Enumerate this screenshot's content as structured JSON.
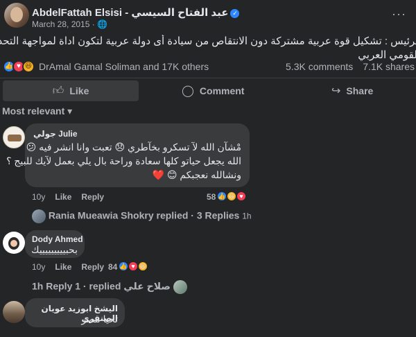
{
  "post": {
    "page_name": "AbdelFattah Elsisi - عبد الفتاح السيسي",
    "date": "March 28, 2015 · ",
    "text_line1": "الرئيس : تشكيل قوة عربية مشتركة دون الانتقاص من سيادة أى دولة عربية لتكون اداة لمواجهة التحديات التى تواجه الأمن",
    "text_line2": "القومي العربي"
  },
  "reactions": {
    "reactors": "DrAmal Gamal Soliman and 17K others",
    "comments": "5.3K comments",
    "shares": "7.1K shares"
  },
  "actions": {
    "like": "Like",
    "comment": "Comment",
    "share": "Share"
  },
  "sort_label": "Most relevant",
  "comments": [
    {
      "author": "جولي Julie",
      "lines": [
        "مْشآن الله لآ تسكرو بخآطري 😞 تعبت وانا انشر فيه 😕",
        "الله يجعل حياتو كلها سعادة وراحة بال يلي بعمل لآيك للبيج ؟",
        "ونشالله نعجبكم 😊 ❤️"
      ],
      "time": "10y",
      "like": "Like",
      "reply": "Reply",
      "reaction_count": "58"
    },
    {
      "author": "Dody Ahmed",
      "lines": [
        "بحبيييييييييك"
      ],
      "time": "10y",
      "like": "Like",
      "reply": "Reply",
      "reaction_count": "84"
    },
    {
      "author": "اليشخ ابوزيد عويان الصنقري",
      "lines": [
        "تحيا مصر"
      ]
    }
  ],
  "reply_summary_1": {
    "name": "Rania Mueawia Shokry replied",
    "dot": " · ",
    "count": "3 Replies",
    "time": "1h"
  },
  "reply_summary_2": {
    "count": "1h Reply",
    "text": "1 · replied صلاح علي"
  },
  "colors": {
    "background": "#242526",
    "bubble": "#3a3b3c",
    "accent": "#2d88ff"
  }
}
